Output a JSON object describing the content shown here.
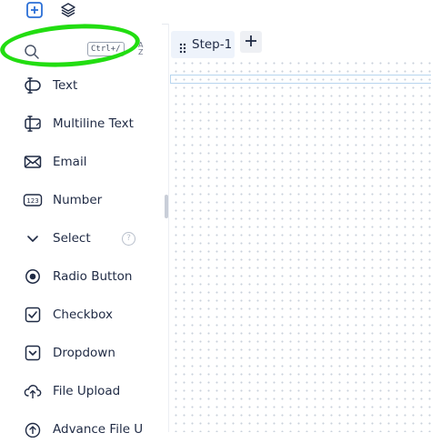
{
  "toolbar": {
    "add_icon": "plus-square-icon",
    "layers_icon": "layers-icon"
  },
  "search": {
    "shortcut": "Ctrl+/",
    "sort_top": "A",
    "sort_bottom": "Z"
  },
  "fields": [
    {
      "label": "Text",
      "icon": "text-field-icon"
    },
    {
      "label": "Multiline Text",
      "icon": "multiline-text-icon"
    },
    {
      "label": "Email",
      "icon": "envelope-icon"
    },
    {
      "label": "Number",
      "icon": "number-123-icon"
    },
    {
      "label": "Select",
      "icon": "chevron-down-icon",
      "help": "?"
    },
    {
      "label": "Radio Button",
      "icon": "radio-icon"
    },
    {
      "label": "Checkbox",
      "icon": "checkbox-icon"
    },
    {
      "label": "Dropdown",
      "icon": "dropdown-icon"
    },
    {
      "label": "File Upload",
      "icon": "cloud-upload-icon"
    },
    {
      "label": "Advance File U",
      "icon": "upload-icon"
    }
  ],
  "tabs": [
    {
      "label": "Step-1"
    }
  ],
  "colors": {
    "accent": "#2b6fd6",
    "text": "#1f2a44",
    "highlight": "#22dd11",
    "tab_bg": "#eef3fb"
  }
}
